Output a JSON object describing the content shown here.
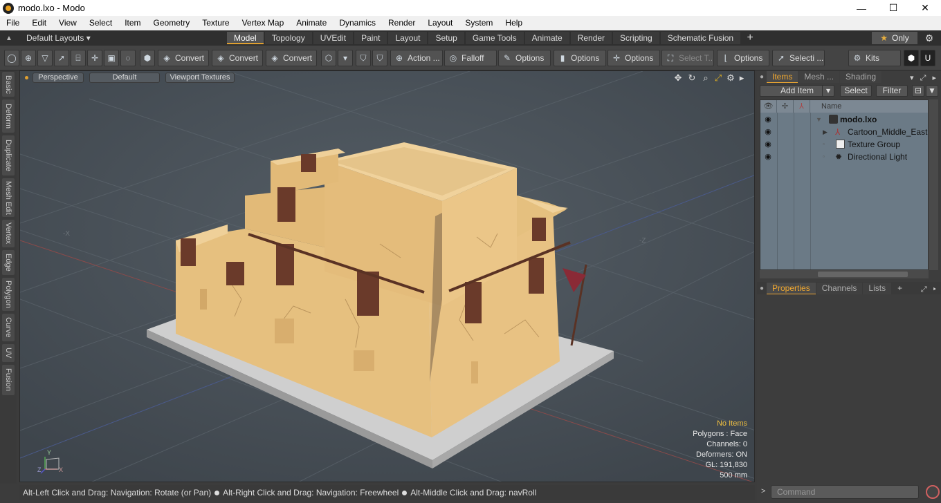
{
  "window": {
    "title": "modo.lxo - Modo",
    "minimize": "—",
    "maximize": "☐",
    "close": "✕"
  },
  "menu": [
    "File",
    "Edit",
    "View",
    "Select",
    "Item",
    "Geometry",
    "Texture",
    "Vertex Map",
    "Animate",
    "Dynamics",
    "Render",
    "Layout",
    "System",
    "Help"
  ],
  "layouts": {
    "selector": "Default Layouts ▾",
    "tabs": [
      "Model",
      "Topology",
      "UVEdit",
      "Paint",
      "Layout",
      "Setup",
      "Game Tools",
      "Animate",
      "Render",
      "Scripting",
      "Schematic Fusion"
    ],
    "active": "Model",
    "add": "+",
    "only": "Only",
    "star": "★",
    "gear": "⚙"
  },
  "toolbar": {
    "convert1": "Convert",
    "convert2": "Convert",
    "convert3": "Convert",
    "action": "Action ...",
    "falloff": "Falloff",
    "options1": "Options",
    "options2": "Options",
    "options3": "Options",
    "select_t": "Select T...",
    "options4": "Options",
    "selecti": "Selecti ...",
    "kits": "Kits"
  },
  "left_tabs": [
    "Basic",
    "Deform",
    "Duplicate",
    "Mesh Edit",
    "Vertex",
    "Edge",
    "Polygon",
    "Curve",
    "UV",
    "Fusion"
  ],
  "viewport": {
    "view": "Perspective",
    "shading": "Default",
    "textures": "Viewport Textures",
    "axis_x": "-X",
    "axis_z": "-Z",
    "gizmo": {
      "y": "Y",
      "z": "Z",
      "x": "X"
    },
    "info": {
      "no_items": "No Items",
      "polygons": "Polygons : Face",
      "channels": "Channels: 0",
      "deformers": "Deformers: ON",
      "gl": "GL: 191,830",
      "scale": "500 mm"
    }
  },
  "status": {
    "part1": "Alt-Left Click and Drag: Navigation: Rotate (or Pan)",
    "part2": "Alt-Right Click and Drag: Navigation: Freewheel",
    "part3": "Alt-Middle Click and Drag: navRoll"
  },
  "items_panel": {
    "tabs": [
      "Items",
      "Mesh ...",
      "Shading"
    ],
    "add_item": "Add Item",
    "select": "Select",
    "filter": "Filter",
    "col_name": "Name",
    "rows": [
      {
        "name": "modo.lxo"
      },
      {
        "name": "Cartoon_Middle_East..."
      },
      {
        "name": "Texture Group"
      },
      {
        "name": "Directional Light"
      }
    ]
  },
  "props_panel": {
    "tabs": [
      "Properties",
      "Channels",
      "Lists"
    ],
    "add": "+"
  },
  "command": {
    "placeholder": "Command",
    "arrow": ">"
  },
  "colors": {
    "accent": "#f0a830",
    "wall": "#e8c182",
    "wall_shade": "#d6ad6c",
    "wood": "#5a3224",
    "base": "#c8c8c8"
  }
}
